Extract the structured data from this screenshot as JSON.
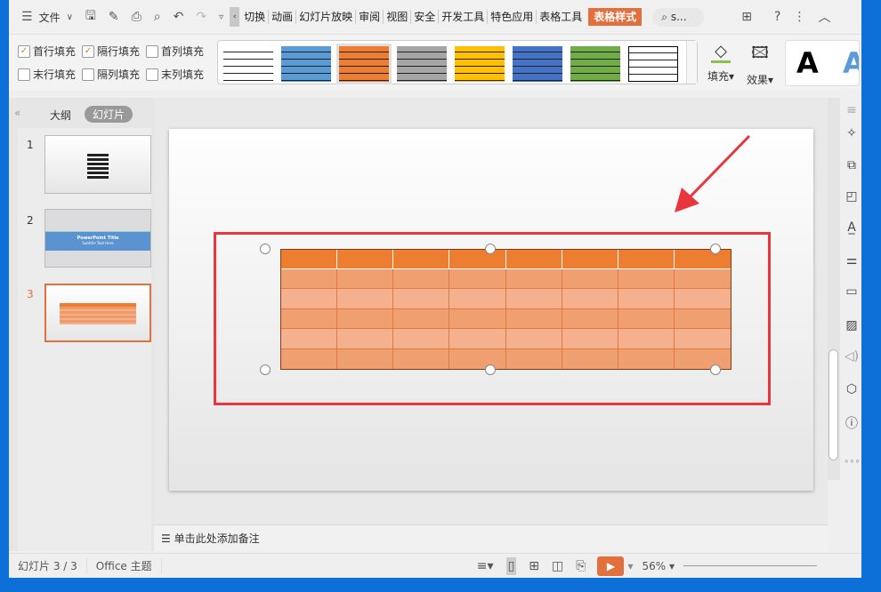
{
  "titlebar": {
    "menu_label": "文件",
    "tabs": [
      "切换",
      "动画",
      "幻灯片放映",
      "审阅",
      "视图",
      "安全",
      "开发工具",
      "特色应用",
      "表格工具"
    ],
    "active_tab": "表格样式",
    "search_placeholder": "s..."
  },
  "ribbon": {
    "options": [
      {
        "label": "首行填充",
        "checked": true
      },
      {
        "label": "隔行填充",
        "checked": true
      },
      {
        "label": "首列填充",
        "checked": false
      },
      {
        "label": "末行填充",
        "checked": false
      },
      {
        "label": "隔列填充",
        "checked": false
      },
      {
        "label": "末列填充",
        "checked": false
      }
    ],
    "styles": [
      {
        "color": "#ffffff",
        "name": "none"
      },
      {
        "color": "#5b9bd5"
      },
      {
        "color": "#ed7d31",
        "selected": true
      },
      {
        "color": "#a5a5a5"
      },
      {
        "color": "#ffc000"
      },
      {
        "color": "#4472c4"
      },
      {
        "color": "#70ad47"
      },
      {
        "color": "#ffffff",
        "name": "grid"
      }
    ],
    "fill_label": "填充",
    "effect_label": "效果",
    "text_style_letter": "A"
  },
  "panel": {
    "tabs": [
      "大纲",
      "幻灯片"
    ],
    "active": "幻灯片",
    "slides": [
      {
        "num": "1"
      },
      {
        "num": "2",
        "title": "PowerPoint Title",
        "subtitle": "Subtitle Text Here"
      },
      {
        "num": "3",
        "selected": true
      }
    ]
  },
  "table": {
    "columns": 8,
    "rows": 6,
    "header_color": "#ed7d31",
    "band1_color": "#f0a070",
    "band2_color": "#f5b08e"
  },
  "notes": {
    "placeholder": "单击此处添加备注"
  },
  "status": {
    "slide_info": "幻灯片 3 / 3",
    "theme": "Office 主题",
    "zoom": "56%"
  },
  "colors": {
    "accent": "#e2703e",
    "annotation": "#e8363c"
  }
}
